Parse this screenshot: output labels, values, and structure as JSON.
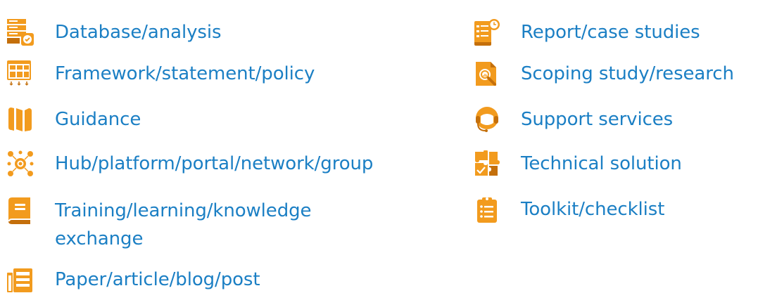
{
  "colors": {
    "label": "#1b7fc4",
    "icon": "#f29b1e",
    "icon_dark": "#c46f0b",
    "icon_detail": "#ffffff"
  },
  "left_column": [
    {
      "label": "Database/analysis",
      "icon": "database-icon"
    },
    {
      "label": "Framework/statement/policy",
      "icon": "framework-icon"
    },
    {
      "label": "Guidance",
      "icon": "map-icon"
    },
    {
      "label": "Hub/platform/portal/network/group",
      "icon": "hub-icon"
    },
    {
      "label_line1": "Training/learning/knowledge",
      "label_line2": "exchange",
      "icon": "book-icon"
    },
    {
      "label": "Paper/article/blog/post",
      "icon": "newspaper-icon"
    }
  ],
  "right_column": [
    {
      "label": "Report/case studies",
      "icon": "report-icon"
    },
    {
      "label": "Scoping study/research",
      "icon": "magnifier-document-icon"
    },
    {
      "label": "Support services",
      "icon": "headset-icon"
    },
    {
      "label": "Technical solution",
      "icon": "puzzle-icon"
    },
    {
      "label": "Toolkit/checklist",
      "icon": "clipboard-icon"
    }
  ]
}
